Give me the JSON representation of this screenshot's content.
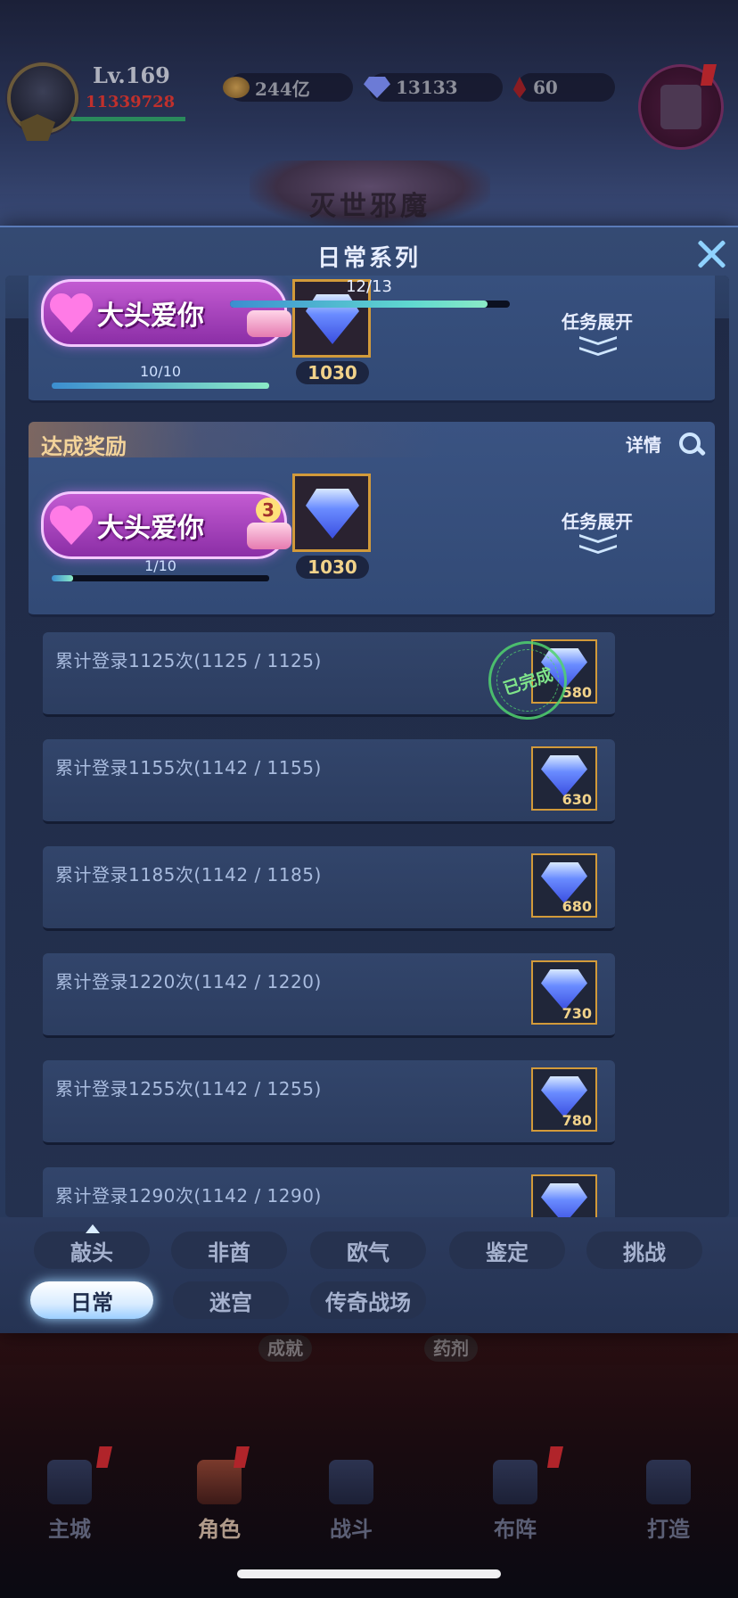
{
  "hud": {
    "level": "Lv.169",
    "power": "11339728",
    "gold": "244亿",
    "gems": "13133",
    "blood": "60",
    "boss_title": "灭世邪魔"
  },
  "dialog": {
    "title": "日常系列",
    "progress_label": "12/13",
    "progress": 0.92
  },
  "card_prev": {
    "event_name": "大头爱你",
    "progress_label": "10/10",
    "progress": 1.0,
    "reward_count": "1030",
    "expand_label": "任务展开"
  },
  "card_main": {
    "title": "达成奖励",
    "detail_label": "详情",
    "event_name": "大头爱你",
    "event_badge_number": "3",
    "progress_label": "1/10",
    "progress": 0.1,
    "reward_count": "1030",
    "expand_label": "任务展开"
  },
  "tasks": [
    {
      "text": "累计登录1125次(1125 / 1125)",
      "reward": "580",
      "completed": true
    },
    {
      "text": "累计登录1155次(1142 / 1155)",
      "reward": "630"
    },
    {
      "text": "累计登录1185次(1142 / 1185)",
      "reward": "680"
    },
    {
      "text": "累计登录1220次(1142 / 1220)",
      "reward": "730"
    },
    {
      "text": "累计登录1255次(1142 / 1255)",
      "reward": "780"
    },
    {
      "text": "累计登录1290次(1142 / 1290)",
      "reward": ""
    }
  ],
  "completed_stamp": "已完成",
  "tabs_row1": [
    "敲头",
    "非酋",
    "欧气",
    "鉴定",
    "挑战"
  ],
  "tabs_row2": [
    "日常",
    "迷宫",
    "传奇战场"
  ],
  "bottom_tags": [
    "成就",
    "药剂"
  ],
  "main_nav": [
    "主城",
    "角色",
    "战斗",
    "布阵",
    "打造"
  ]
}
